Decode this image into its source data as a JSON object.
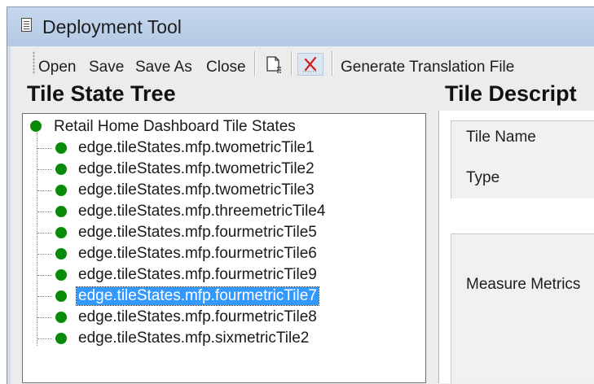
{
  "window": {
    "title": "Deployment Tool",
    "icon": "document-icon"
  },
  "toolbar": {
    "open_label": "Open",
    "save_label": "Save",
    "save_as_label": "Save As",
    "close_label": "Close",
    "new_tile_icon": "new-document-icon",
    "delete_icon": "delete-x-icon",
    "generate_label": "Generate Translation File"
  },
  "tree_panel": {
    "heading": "Tile State Tree",
    "root": "Retail Home Dashboard Tile States",
    "items": [
      "edge.tileStates.mfp.twometricTile1",
      "edge.tileStates.mfp.twometricTile2",
      "edge.tileStates.mfp.twometricTile3",
      "edge.tileStates.mfp.threemetricTile4",
      "edge.tileStates.mfp.fourmetricTile5",
      "edge.tileStates.mfp.fourmetricTile6",
      "edge.tileStates.mfp.fourmetricTile9",
      "edge.tileStates.mfp.fourmetricTile7",
      "edge.tileStates.mfp.fourmetricTile8",
      "edge.tileStates.mfp.sixmetricTile2"
    ],
    "selected": "edge.tileStates.mfp.fourmetricTile7"
  },
  "desc_panel": {
    "heading": "Tile Descript",
    "tile_name_label": "Tile Name",
    "type_label": "Type",
    "measure_metrics_label": "Measure Metrics"
  },
  "colors": {
    "node_green": "#098a09",
    "selection_blue": "#3399ff",
    "titlebar": "#bcd0ea"
  }
}
